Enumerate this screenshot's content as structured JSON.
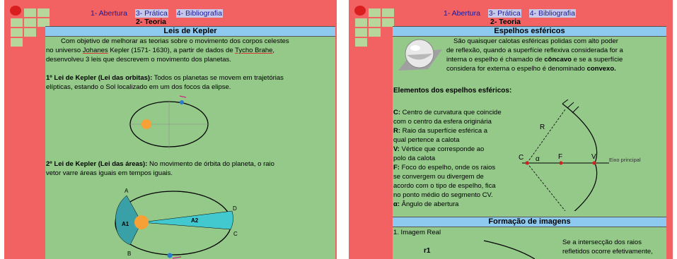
{
  "left": {
    "nav": {
      "item1": "1- Abertura",
      "item3": "3- Prática",
      "item4": "4- Bibliografia",
      "current": "2- Teoria"
    },
    "section_title": "Leis de Kepler",
    "intro": {
      "line1": "Com objetivo de melhorar as teorias sobre o movimento dos corpos celestes",
      "line2_a": "no universo",
      "line2_name1": "Johanes",
      "line2_b": "Kepler (1571- 1630), a partir de dados de",
      "line2_name2": "Tycho Brahe",
      "line2_c": ",",
      "line3": "desenvolveu 3 leis que descrevem o movimento dos planetas."
    },
    "law1": {
      "title": "1º Lei de Kepler (Lei das orbitas):",
      "text_a": "Todos os planetas se movem em trajetórias",
      "text_b": "elípticas, estando o Sol localizado em um dos focos da elipse."
    },
    "law2": {
      "title": "2º Lei de Kepler (Lei das áreas):",
      "text_a": "No movimento de órbita do planeta, o raio",
      "text_b": "vetor varre áreas iguais em tempos iguais."
    },
    "diagram2_labels": {
      "a": "A",
      "b": "B",
      "c": "C",
      "d": "D",
      "a1": "A1",
      "a2": "A2"
    }
  },
  "right": {
    "nav": {
      "item1": "1- Abertura",
      "item3": "3- Prática",
      "item4": "4- Bibliografia",
      "current": "2- Teoria"
    },
    "section_title": "Espelhos esféricos",
    "intro": {
      "line1": "São quaisquer calotas esféricas polidas com alto poder",
      "line2": "de reflexão, quando a superfície reflexiva considerada for a",
      "line3_a": "interna o espelho é chamado de",
      "line3_b": "côncavo",
      "line3_c": "e se a superfície",
      "line4_a": "considera for externa o espelho é denominado",
      "line4_b": "convexo."
    },
    "elements_title": "Elementos dos espelhos esféricos:",
    "elements": {
      "c_key": "C:",
      "c_1": "Centro de curvatura que coincide",
      "c_2": "com o centro da esfera originária",
      "r_key": "R:",
      "r_1": "Raio da superfície esférica a",
      "r_2": "qual pertence a calota",
      "v_key": "V:",
      "v_1": "Vértice que corresponde ao",
      "v_2": "polo da calota",
      "f_key": "F:",
      "f_1": "Foco do espelho, onde os raios",
      "f_2": "se convergem ou divergem de",
      "f_3": "acordo com o tipo de espelho, fica",
      "f_4": "no ponto médio do segmento CV.",
      "a_key": "α:",
      "a_1": "Ângulo de abertura"
    },
    "mirror_labels": {
      "c": "C",
      "alpha": "α",
      "f": "F",
      "v": "V",
      "r": "R",
      "axis": "Eixo principal"
    },
    "section2_title": "Formação de imagens",
    "image_real": "1. Imagem Real",
    "r1": "r1",
    "side_text1": "Se a intersecção dos raios",
    "side_text2": "refletidos ocorre efetivamente,"
  },
  "colors": {
    "background": "#f26262",
    "content": "#94c98a",
    "section_header": "#8ecaf0",
    "nav_text": "#1a1a9a"
  }
}
